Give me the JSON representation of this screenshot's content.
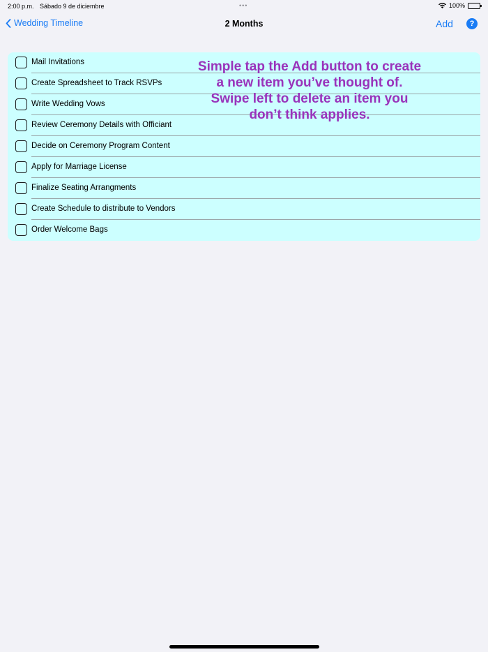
{
  "status_bar": {
    "time": "2:00 p.m.",
    "date": "Sábado 9 de diciembre",
    "dots": "•••",
    "battery": "100%"
  },
  "nav": {
    "back_label": "Wedding Timeline",
    "title": "2 Months",
    "add_label": "Add",
    "help_label": "?"
  },
  "items": [
    {
      "label": "Mail Invitations"
    },
    {
      "label": "Create Spreadsheet to Track RSVPs"
    },
    {
      "label": "Write Wedding Vows"
    },
    {
      "label": "Review Ceremony Details with Officiant"
    },
    {
      "label": "Decide on Ceremony Program Content"
    },
    {
      "label": "Apply for Marriage License"
    },
    {
      "label": "Finalize Seating Arrangments"
    },
    {
      "label": "Create Schedule to distribute to Vendors"
    },
    {
      "label": "Order Welcome Bags"
    }
  ],
  "hint": {
    "text": "Simple tap the Add button to create a new item you’ve thought of. Swipe left to delete an item you don’t think applies."
  },
  "colors": {
    "accent": "#1a7cf5",
    "list_background": "#ccffff",
    "hint_text": "#9933bb",
    "page_background": "#f2f2f7"
  }
}
